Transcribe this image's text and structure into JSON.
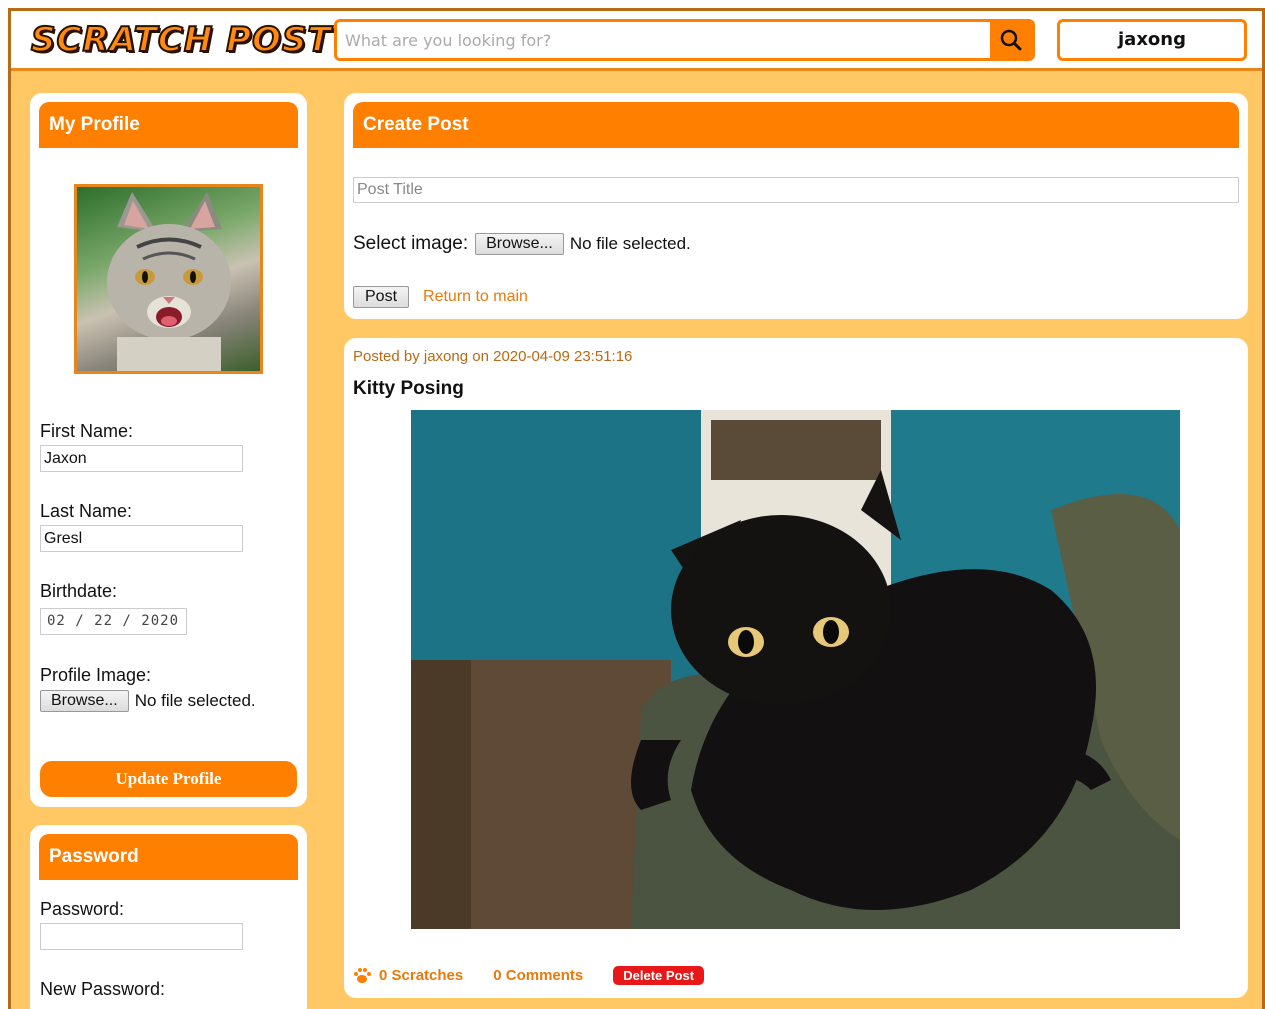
{
  "header": {
    "logo_text": "SCRATCH POST",
    "search_placeholder": "What are you looking for?",
    "user_label": "jaxong"
  },
  "profile": {
    "title": "My Profile",
    "first_name_label": "First Name:",
    "first_name_value": "Jaxon",
    "last_name_label": "Last Name:",
    "last_name_value": "Gresl",
    "birthdate_label": "Birthdate:",
    "birthdate_value": "02 / 22 / 2020",
    "profile_image_label": "Profile Image:",
    "browse_label": "Browse...",
    "no_file_text": "No file selected.",
    "update_button": "Update Profile"
  },
  "password": {
    "title": "Password",
    "password_label": "Password:",
    "new_password_label": "New Password:"
  },
  "create_post": {
    "title": "Create Post",
    "title_placeholder": "Post Title",
    "select_image_label": "Select image:",
    "browse_label": "Browse...",
    "no_file_text": "No file selected.",
    "post_button": "Post",
    "return_link": "Return to main"
  },
  "post": {
    "meta": "Posted by jaxong on 2020-04-09 23:51:16",
    "title": "Kitty Posing",
    "scratches": "0 Scratches",
    "comments": "0 Comments",
    "delete_button": "Delete Post"
  },
  "colors": {
    "accent": "#ff7f00",
    "background": "#ffc864",
    "delete": "#e81818"
  }
}
